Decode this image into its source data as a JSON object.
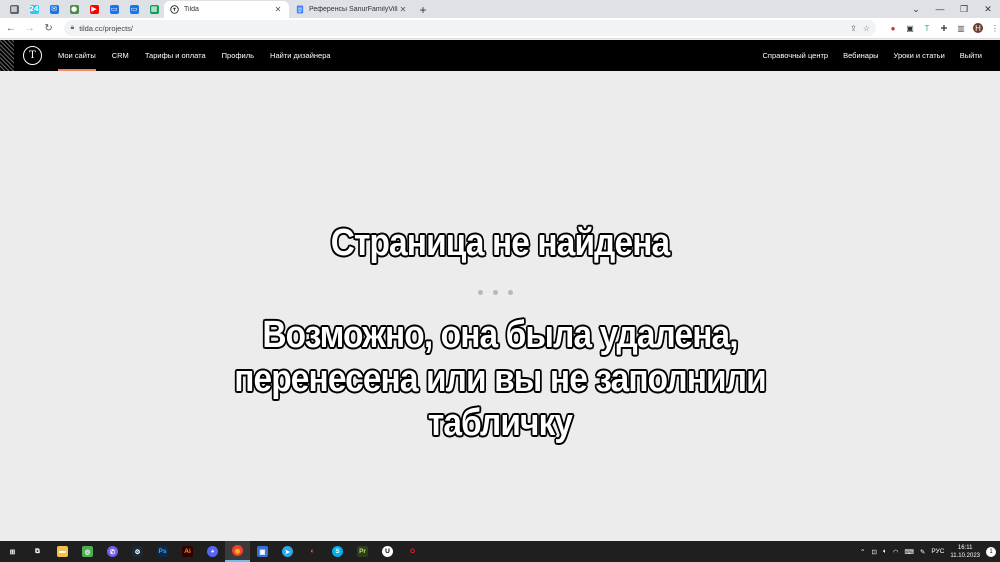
{
  "browser": {
    "pinned_tabs": [
      {
        "name": "pinned-tab-1",
        "icon": "grid-icon",
        "glyph": "▦",
        "color": "#5f6368"
      },
      {
        "name": "pinned-tab-2",
        "icon": "bitrix24-icon",
        "glyph": "24",
        "color": "#2fc6f6"
      },
      {
        "name": "pinned-tab-3",
        "icon": "mail-icon",
        "glyph": "✉",
        "color": "#1a73e8"
      },
      {
        "name": "pinned-tab-4",
        "icon": "globe-icon",
        "glyph": "●",
        "color": "#4c8c4a"
      },
      {
        "name": "pinned-tab-5",
        "icon": "youtube-icon",
        "glyph": "▶",
        "color": "#ff0000"
      },
      {
        "name": "pinned-tab-6",
        "icon": "messages-icon",
        "glyph": "▭",
        "color": "#1a73e8"
      },
      {
        "name": "pinned-tab-7",
        "icon": "chat-icon",
        "glyph": "▭",
        "color": "#1a73e8"
      },
      {
        "name": "pinned-tab-8",
        "icon": "sheets-icon",
        "glyph": "▦",
        "color": "#0f9d58"
      }
    ],
    "tabs": [
      {
        "title": "Tilda",
        "active": true
      },
      {
        "title": "Референсы SanurFamilyVillas - ...",
        "active": false
      }
    ],
    "url": "tilda.cc/projects/"
  },
  "tilda": {
    "logo": "T",
    "nav": [
      "Мои сайты",
      "CRM",
      "Тарифы и оплата",
      "Профиль",
      "Найти дизайнера"
    ],
    "right_nav": [
      "Справочный центр",
      "Вебинары",
      "Уроки и статьи",
      "Выйти"
    ],
    "accent_color": "#f3866a"
  },
  "content": {
    "title": "Страница не найдена",
    "subtitle_lines": [
      "Возможно, она была удалена,",
      "перенесена или вы не заполнили",
      "табличку"
    ]
  },
  "taskbar": {
    "apps": [
      {
        "name": "start-icon",
        "glyph": "⊞",
        "color": "#1f1f1f",
        "fg": "#fff"
      },
      {
        "name": "task-view-icon",
        "glyph": "⧉",
        "color": "#1f1f1f",
        "fg": "#fff"
      },
      {
        "name": "file-explorer-icon",
        "glyph": "▬",
        "color": "#f2c14e",
        "fg": "#fff"
      },
      {
        "name": "xbox-icon",
        "glyph": "◎",
        "color": "#4caf50",
        "fg": "#fff"
      },
      {
        "name": "viber-icon",
        "glyph": "✆",
        "color": "#7360f2",
        "fg": "#fff"
      },
      {
        "name": "steam-icon",
        "glyph": "⚙",
        "color": "#1b2838",
        "fg": "#fff"
      },
      {
        "name": "photoshop-icon",
        "glyph": "Ps",
        "color": "#0b2a4a",
        "fg": "#31a8ff"
      },
      {
        "name": "illustrator-icon",
        "glyph": "Ai",
        "color": "#330000",
        "fg": "#ff9a00"
      },
      {
        "name": "discord-icon",
        "glyph": "◕",
        "color": "#5865f2",
        "fg": "#fff"
      },
      {
        "name": "chrome-icon",
        "glyph": "◉",
        "color": "#ea4335",
        "fg": "#fbbc05"
      },
      {
        "name": "photos-icon",
        "glyph": "▣",
        "color": "#3b6fd8",
        "fg": "#fff"
      },
      {
        "name": "telegram-icon",
        "glyph": "➤",
        "color": "#29a9eb",
        "fg": "#fff"
      },
      {
        "name": "blender-icon",
        "glyph": "◐",
        "color": "#1f1f1f",
        "fg": "#f5792a"
      },
      {
        "name": "skype-icon",
        "glyph": "S",
        "color": "#00aff0",
        "fg": "#fff"
      },
      {
        "name": "pureref-icon",
        "glyph": "Pr",
        "color": "#2e3b1f",
        "fg": "#b6e05a"
      },
      {
        "name": "unreal-icon",
        "glyph": "U",
        "color": "#ffffff",
        "fg": "#000"
      },
      {
        "name": "opera-icon",
        "glyph": "O",
        "color": "#1f1f1f",
        "fg": "#ff1b2d"
      }
    ],
    "tray_lang": "РУС",
    "time": "16:11",
    "date": "11.10.2023"
  }
}
